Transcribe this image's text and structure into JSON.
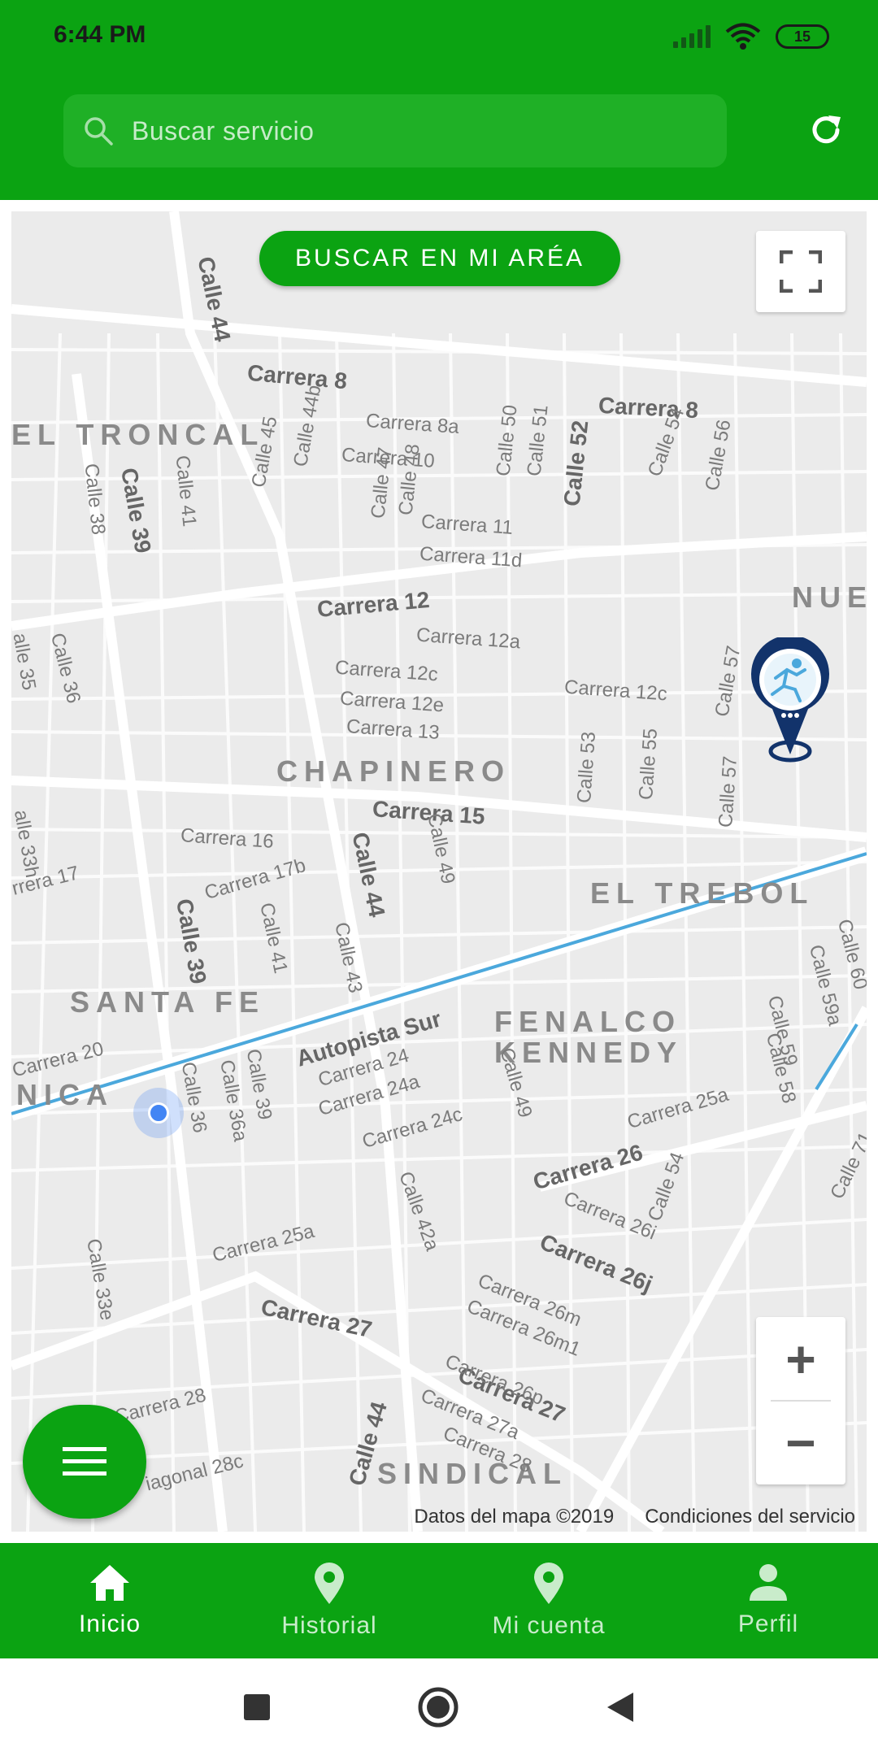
{
  "status_bar": {
    "time": "6:44 PM",
    "battery": "15"
  },
  "header": {
    "search_placeholder": "Buscar servicio"
  },
  "map": {
    "search_area_label": "BUSCAR EN MI ARÉA",
    "attribution": "Datos del mapa ©2019",
    "terms": "Condiciones del servicio",
    "zoom_in": "+",
    "zoom_out": "−",
    "labels": {
      "troncal": "EL TRONCAL",
      "chapinero": "CHAPINERO",
      "trebol": "EL TREBOL",
      "santafe": "SANTA FE",
      "fenalco": "FENALCO",
      "kennedy": "KENNEDY",
      "nica": "NICA",
      "sindical": "SINDICAL",
      "nue": "NUE",
      "carrera8a": "Carrera 8",
      "carrera8b": "Carrera 8",
      "carrera12": "Carrera 12",
      "carrera15": "Carrera 15",
      "carrera26": "Carrera 26",
      "carrera27": "Carrera 27",
      "carrera27b": "Carrera 27",
      "calle44a": "Calle 44",
      "calle44b": "Calle 44",
      "calle44c": "Calle 44",
      "calle39a": "Calle 39",
      "calle39b": "Calle 39",
      "calle52": "Calle 52",
      "autopista": "Autopista Sur",
      "carrera8a_small": "Carrera 8a",
      "carrera10": "Carrera 10",
      "carrera11": "Carrera 11",
      "carrera11d": "Carrera 11d",
      "carrera12a": "Carrera 12a",
      "carrera12c": "Carrera 12c",
      "carrera12c2": "Carrera 12c",
      "carrera12e": "Carrera 12e",
      "carrera13": "Carrera 13",
      "carrera16": "Carrera 16",
      "carrera17b": "Carrera 17b",
      "carrera17": "rrera 17",
      "carrera20": "Carrera 20",
      "carrera24": "Carrera 24",
      "carrera24a": "Carrera 24a",
      "carrera24c": "Carrera 24c",
      "carrera25a": "Carrera 25a",
      "carrera25a2": "Carrera 25a",
      "carrera26i": "Carrera 26i",
      "carrera26j": "Carrera 26j",
      "carrera26m": "Carrera 26m",
      "carrera26m1": "Carrera 26m1",
      "carrera26p": "Carrera 26p",
      "carrera27a": "Carrera 27a",
      "carrera28": "Carrera 28",
      "carrera28b": "Carrera 28",
      "diagonal28c": "iagonal 28c",
      "calle41": "Calle 41",
      "calle38": "Calle 38",
      "calle36": "Calle 36",
      "calle35": "alle 35",
      "calle45": "Calle 45",
      "calle44b_small": "Calle 44b",
      "calle47": "Calle 47",
      "calle48": "Calle 48",
      "calle50": "Calle 50",
      "calle51": "Calle 51",
      "calle54": "Calle 54",
      "calle56": "Calle 56",
      "calle57": "Calle 57",
      "calle53": "Calle 53",
      "calle55": "Calle 55",
      "calle49": "Calle 49",
      "calle43": "Calle 43",
      "calle41b": "Calle 41",
      "calle39c": "Calle 39",
      "calle36a": "Calle 36a",
      "calle36b": "Calle 36",
      "calle42a": "Calle 42a",
      "calle33e": "Calle 33e",
      "calle33h": "alle 33h",
      "calle49b": "Calle 49",
      "calle54b": "Calle 54",
      "calle57b": "Calle 57",
      "calle59": "Calle 59",
      "calle59a": "Calle 59a",
      "calle58": "Calle 58",
      "calle60": "Calle 60",
      "calle71": "Calle 71"
    }
  },
  "bottom_nav": [
    {
      "label": "Inicio",
      "icon": "home-icon",
      "active": true
    },
    {
      "label": "Historial",
      "icon": "location-pin-icon",
      "active": false
    },
    {
      "label": "Mi cuenta",
      "icon": "location-pin-icon",
      "active": false
    },
    {
      "label": "Perfil",
      "icon": "person-icon",
      "active": false
    }
  ],
  "colors": {
    "primary": "#0ba312",
    "map_bg": "#ebebeb",
    "road": "#ffffff",
    "highway": "#4ba8dc",
    "marker": "#12336b",
    "user_dot": "#4285f4"
  }
}
